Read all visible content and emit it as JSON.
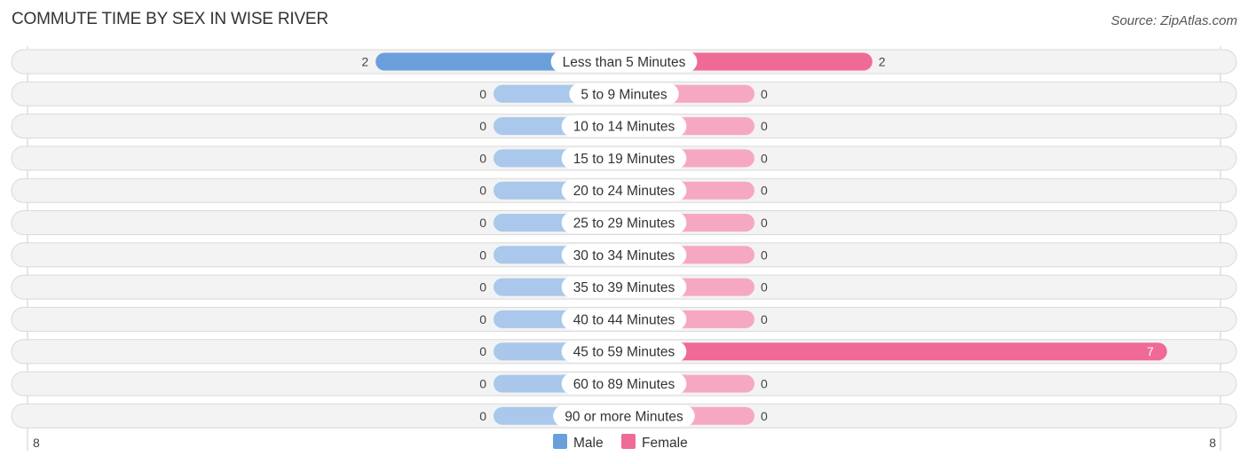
{
  "header": {
    "title": "COMMUTE TIME BY SEX IN WISE RIVER",
    "source": "Source: ZipAtlas.com"
  },
  "chart_data": {
    "type": "bar",
    "orientation": "horizontal-diverging",
    "title": "COMMUTE TIME BY SEX IN WISE RIVER",
    "categories": [
      "Less than 5 Minutes",
      "5 to 9 Minutes",
      "10 to 14 Minutes",
      "15 to 19 Minutes",
      "20 to 24 Minutes",
      "25 to 29 Minutes",
      "30 to 34 Minutes",
      "35 to 39 Minutes",
      "40 to 44 Minutes",
      "45 to 59 Minutes",
      "60 to 89 Minutes",
      "90 or more Minutes"
    ],
    "series": [
      {
        "name": "Male",
        "values": [
          2,
          0,
          0,
          0,
          0,
          0,
          0,
          0,
          0,
          0,
          0,
          0
        ],
        "color": "#6a9fdc",
        "zero_color": "#a9c8eb"
      },
      {
        "name": "Female",
        "values": [
          2,
          0,
          0,
          0,
          0,
          0,
          0,
          0,
          0,
          7,
          0,
          0
        ],
        "color": "#f06a96",
        "zero_color": "#f6a8c2"
      }
    ],
    "axis": {
      "left_label": "8",
      "right_label": "8",
      "xlim": [
        -8,
        8
      ]
    },
    "legend": {
      "position": "bottom-center",
      "entries": [
        "Male",
        "Female"
      ]
    },
    "xlabel": "",
    "ylabel": ""
  }
}
